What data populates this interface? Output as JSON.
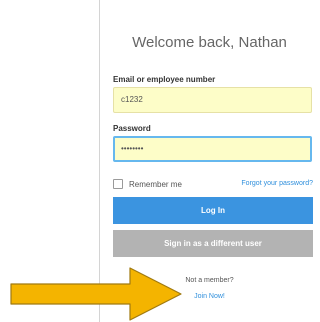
{
  "welcome": "Welcome back, Nathan",
  "email": {
    "label": "Email or employee number",
    "value": "c1232"
  },
  "password": {
    "label": "Password",
    "value": "••••••••"
  },
  "remember_me": "Remember me",
  "forgot_password": "Forgot your password?",
  "buttons": {
    "login": "Log In",
    "different_user": "Sign in as a different user"
  },
  "signup": {
    "prompt": "Not a member?",
    "link": "Join Now!"
  },
  "colors": {
    "primary": "#3b94e0",
    "secondary_button": "#b3b3b3",
    "link": "#2f8fdc",
    "field_bg": "#fdfdc8",
    "arrow": "#f4b400"
  }
}
